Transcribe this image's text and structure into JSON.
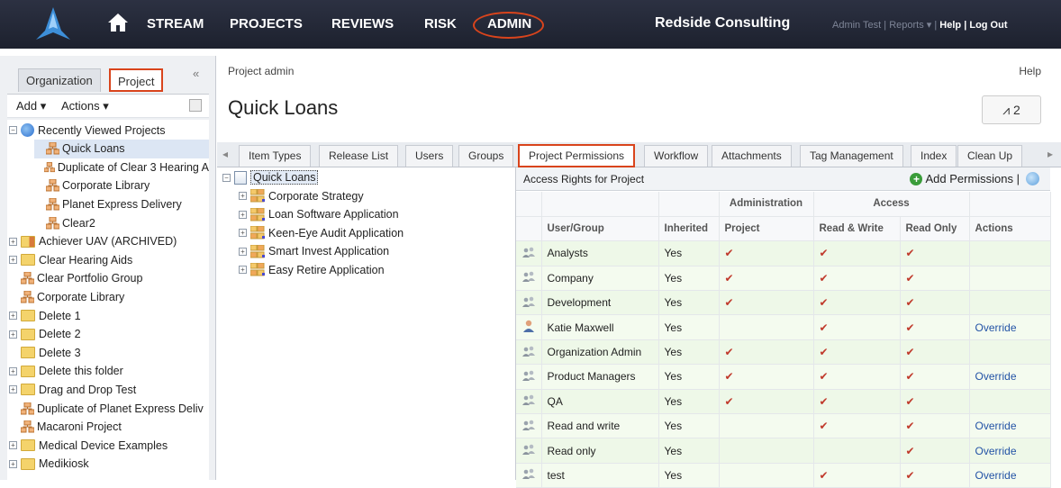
{
  "nav": {
    "links": [
      "STREAM",
      "PROJECTS",
      "REVIEWS",
      "RISK",
      "ADMIN"
    ],
    "company": "Redside Consulting",
    "user": "Admin Test",
    "reports": "Reports",
    "help": "Help",
    "logout": "Log Out"
  },
  "left": {
    "tabs": [
      "Organization",
      "Project"
    ],
    "add_label": "Add",
    "actions_label": "Actions",
    "tree": [
      {
        "label": "Recently Viewed Projects",
        "icon": "globe-icon",
        "level": 0,
        "exp": "−"
      },
      {
        "label": "Quick Loans",
        "icon": "project-icon",
        "level": 1,
        "selected": true
      },
      {
        "label": "Duplicate of Clear 3 Hearing A",
        "icon": "project-icon",
        "level": 1
      },
      {
        "label": "Corporate Library",
        "icon": "project-icon",
        "level": 1
      },
      {
        "label": "Planet Express Delivery",
        "icon": "project-icon",
        "level": 1
      },
      {
        "label": "Clear2",
        "icon": "project-icon",
        "level": 1
      },
      {
        "label": "Achiever UAV (ARCHIVED)",
        "icon": "archived-folder-icon",
        "level": 0,
        "exp": "+"
      },
      {
        "label": "Clear Hearing Aids",
        "icon": "folder-icon",
        "level": 0,
        "exp": "+"
      },
      {
        "label": "Clear Portfolio Group",
        "icon": "project-icon",
        "level": 0
      },
      {
        "label": "Corporate Library",
        "icon": "project-icon",
        "level": 0
      },
      {
        "label": "Delete 1",
        "icon": "folder-icon",
        "level": 0,
        "exp": "+"
      },
      {
        "label": "Delete 2",
        "icon": "folder-icon",
        "level": 0,
        "exp": "+"
      },
      {
        "label": "Delete 3",
        "icon": "folder-icon",
        "level": 0
      },
      {
        "label": "Delete this folder",
        "icon": "folder-icon",
        "level": 0,
        "exp": "+"
      },
      {
        "label": "Drag and Drop Test",
        "icon": "folder-icon",
        "level": 0,
        "exp": "+"
      },
      {
        "label": "Duplicate of Planet Express Deliv",
        "icon": "project-icon",
        "level": 0
      },
      {
        "label": "Macaroni Project",
        "icon": "project-icon",
        "level": 0
      },
      {
        "label": "Medical Device Examples",
        "icon": "folder-icon",
        "level": 0,
        "exp": "+"
      },
      {
        "label": "Medikiosk",
        "icon": "folder-icon",
        "level": 0,
        "exp": "+"
      }
    ]
  },
  "main": {
    "breadcrumb": "Project admin",
    "help": "Help",
    "title": "Quick Loans",
    "pulse": "2",
    "tabs": [
      "Item Types",
      "Release List",
      "Users",
      "Groups",
      "Project Permissions",
      "Workflow",
      "Attachments",
      "Tag Management",
      "Index",
      "Clean Up"
    ],
    "tree": [
      {
        "label": "Quick Loans",
        "root": true
      },
      {
        "label": "Corporate Strategy"
      },
      {
        "label": "Loan Software Application"
      },
      {
        "label": "Keen-Eye Audit Application"
      },
      {
        "label": "Smart Invest Application"
      },
      {
        "label": "Easy Retire Application"
      }
    ],
    "permissions": {
      "title": "Access Rights for Project",
      "add_label": "Add Permissions |",
      "group_headers": {
        "admin": "Administration",
        "access": "Access"
      },
      "headers": [
        "User/Group",
        "Inherited",
        "Project",
        "Read & Write",
        "Read Only",
        "Actions"
      ],
      "rows": [
        {
          "name": "Analysts",
          "kind": "group",
          "inherited": "Yes",
          "project": true,
          "rw": true,
          "ro": true,
          "action": ""
        },
        {
          "name": "Company",
          "kind": "group",
          "inherited": "Yes",
          "project": true,
          "rw": true,
          "ro": true,
          "action": ""
        },
        {
          "name": "Development",
          "kind": "group",
          "inherited": "Yes",
          "project": true,
          "rw": true,
          "ro": true,
          "action": ""
        },
        {
          "name": "Katie Maxwell",
          "kind": "user",
          "inherited": "Yes",
          "project": false,
          "rw": true,
          "ro": true,
          "action": "Override"
        },
        {
          "name": "Organization Admin",
          "kind": "group",
          "inherited": "Yes",
          "project": true,
          "rw": true,
          "ro": true,
          "action": ""
        },
        {
          "name": "Product Managers",
          "kind": "group",
          "inherited": "Yes",
          "project": true,
          "rw": true,
          "ro": true,
          "action": "Override"
        },
        {
          "name": "QA",
          "kind": "group",
          "inherited": "Yes",
          "project": true,
          "rw": true,
          "ro": true,
          "action": ""
        },
        {
          "name": "Read and write",
          "kind": "group",
          "inherited": "Yes",
          "project": false,
          "rw": true,
          "ro": true,
          "action": "Override"
        },
        {
          "name": "Read only",
          "kind": "group",
          "inherited": "Yes",
          "project": false,
          "rw": false,
          "ro": true,
          "action": "Override"
        },
        {
          "name": "test",
          "kind": "group",
          "inherited": "Yes",
          "project": false,
          "rw": true,
          "ro": true,
          "action": "Override"
        }
      ]
    }
  },
  "colors": {
    "nav_bg": "#23273a",
    "highlight": "#d9441c",
    "row_green": "#eef8e8",
    "check": "#c0392b",
    "link": "#2353a6"
  }
}
